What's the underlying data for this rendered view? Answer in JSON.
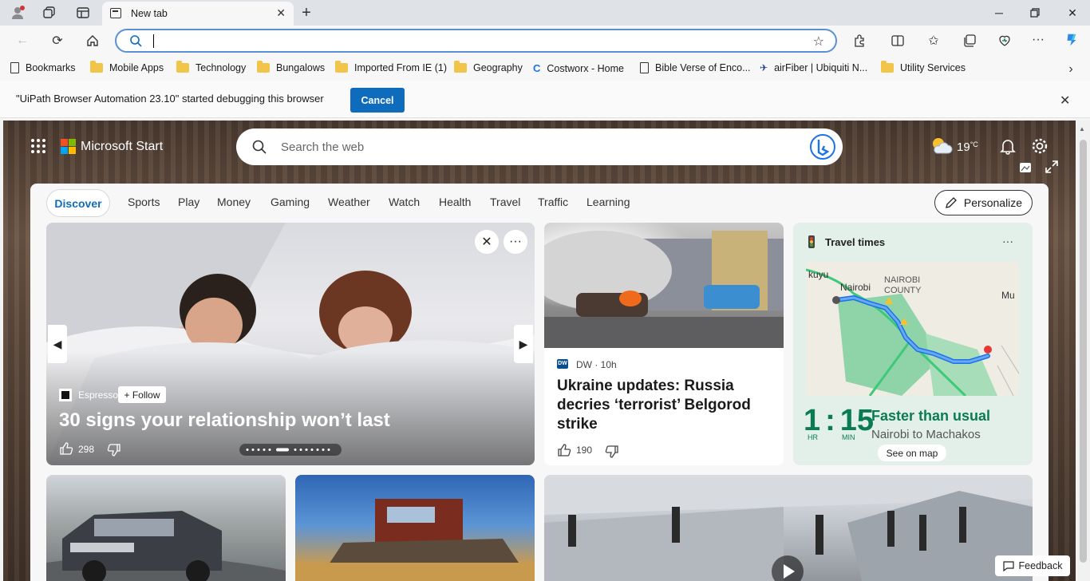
{
  "browser": {
    "tab_title": "New tab",
    "address_value": "",
    "bookmarks": [
      {
        "label": "Bookmarks",
        "icon": "bookmarks-icon"
      },
      {
        "label": "Mobile Apps",
        "icon": "folder-icon"
      },
      {
        "label": "Technology",
        "icon": "folder-icon"
      },
      {
        "label": "Bungalows",
        "icon": "folder-icon"
      },
      {
        "label": "Imported From IE (1)",
        "icon": "folder-icon"
      },
      {
        "label": "Geography",
        "icon": "folder-icon"
      },
      {
        "label": "Costworx - Home",
        "icon": "costworx-icon"
      },
      {
        "label": "Bible Verse of Enco...",
        "icon": "page-icon"
      },
      {
        "label": "airFiber | Ubiquiti N...",
        "icon": "ubiquiti-icon"
      },
      {
        "label": "Utility Services",
        "icon": "folder-icon"
      }
    ],
    "infobar": {
      "message": "\"UiPath Browser Automation 23.10\" started debugging this browser",
      "cancel_label": "Cancel"
    }
  },
  "start": {
    "brand": "Microsoft Start",
    "search_placeholder": "Search the web",
    "weather": {
      "temp": "19",
      "unit": "°C",
      "icon": "partly-cloudy-icon"
    },
    "tabs": [
      "Discover",
      "Sports",
      "Play",
      "Money",
      "Gaming",
      "Weather",
      "Watch",
      "Health",
      "Travel",
      "Traffic",
      "Learning"
    ],
    "personalize_label": "Personalize",
    "hero": {
      "source": "Espresso",
      "follow_label": "+ Follow",
      "title": "30 signs your relationship won’t last",
      "likes": "298"
    },
    "news": {
      "source": "DW · 10h",
      "title": "Ukraine updates: Russia decries ‘terrorist’ Belgorod strike",
      "likes": "190"
    },
    "travel": {
      "title": "Travel times",
      "hours": "1",
      "minutes": "15",
      "hours_unit": "HR",
      "minutes_unit": "MIN",
      "status": "Faster than usual",
      "route": "Nairobi to Machakos",
      "see_map_label": "See on map",
      "map_labels": [
        "kuyu",
        "Nairobi",
        "NAIROBI COUNTY",
        "Mu"
      ],
      "status_color": "#0a7b55"
    },
    "feedback_label": "Feedback"
  }
}
